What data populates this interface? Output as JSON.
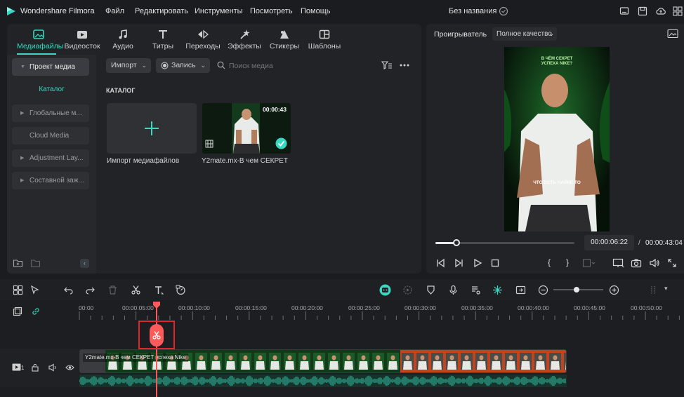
{
  "app": {
    "name": "Wondershare Filmora",
    "project_title": "Без названия"
  },
  "menu": [
    "Файл",
    "Редактировать",
    "Инструменты",
    "Посмотреть",
    "Помощь"
  ],
  "media_tabs": [
    {
      "label": "Медиафайлы",
      "icon": "media-icon",
      "active": true
    },
    {
      "label": "Видеосток",
      "icon": "stock-video-icon"
    },
    {
      "label": "Аудио",
      "icon": "music-note-icon"
    },
    {
      "label": "Титры",
      "icon": "titles-icon"
    },
    {
      "label": "Переходы",
      "icon": "transitions-icon"
    },
    {
      "label": "Эффекты",
      "icon": "effects-icon"
    },
    {
      "label": "Стикеры",
      "icon": "stickers-icon"
    },
    {
      "label": "Шаблоны",
      "icon": "templates-icon"
    }
  ],
  "sidebar": {
    "project_media": "Проект медиа",
    "catalog": "Каталог",
    "items": [
      "Глобальные м...",
      "Cloud Media",
      "Adjustment Lay...",
      "Составной заж..."
    ]
  },
  "media_toolbar": {
    "import_label": "Импорт",
    "record_label": "Запись",
    "search_placeholder": "Поиск медиа"
  },
  "catalog_heading": "КАТАЛОГ",
  "media_items": [
    {
      "label": "Импорт медиафайлов"
    },
    {
      "label": "Y2mate.mx-В чем СЕКРЕТ у...",
      "duration": "00:00:43"
    }
  ],
  "player": {
    "label": "Проигрыватель",
    "quality": "Полное качество",
    "current_time": "00:00:06:22",
    "separator": "/",
    "total_time": "00:00:43:04",
    "progress": 0.15,
    "video_caption_top": "В ЧЁМ СЕКРЕТ УСПЕХА NIKE?",
    "video_caption_bottom": "ЧТО ЕСТЬ НАЙКЕ ТО"
  },
  "timeline": {
    "ticks": [
      "00:00",
      "00:00:05:00",
      "00:00:10:00",
      "00:00:15:00",
      "00:00:20:00",
      "00:00:25:00",
      "00:00:30:00",
      "00:00:35:00",
      "00:00:40:00",
      "00:00:45:00",
      "00:00:50:00"
    ],
    "track_number": "1",
    "clip_title": "Y2mate.mx-В чем СЕКРЕТ успеха Nike"
  },
  "colors": {
    "accent": "#38d9c0",
    "playhead": "#ff5a5a",
    "highlight_box": "#e0262a",
    "waveform": "#2fa98e"
  }
}
